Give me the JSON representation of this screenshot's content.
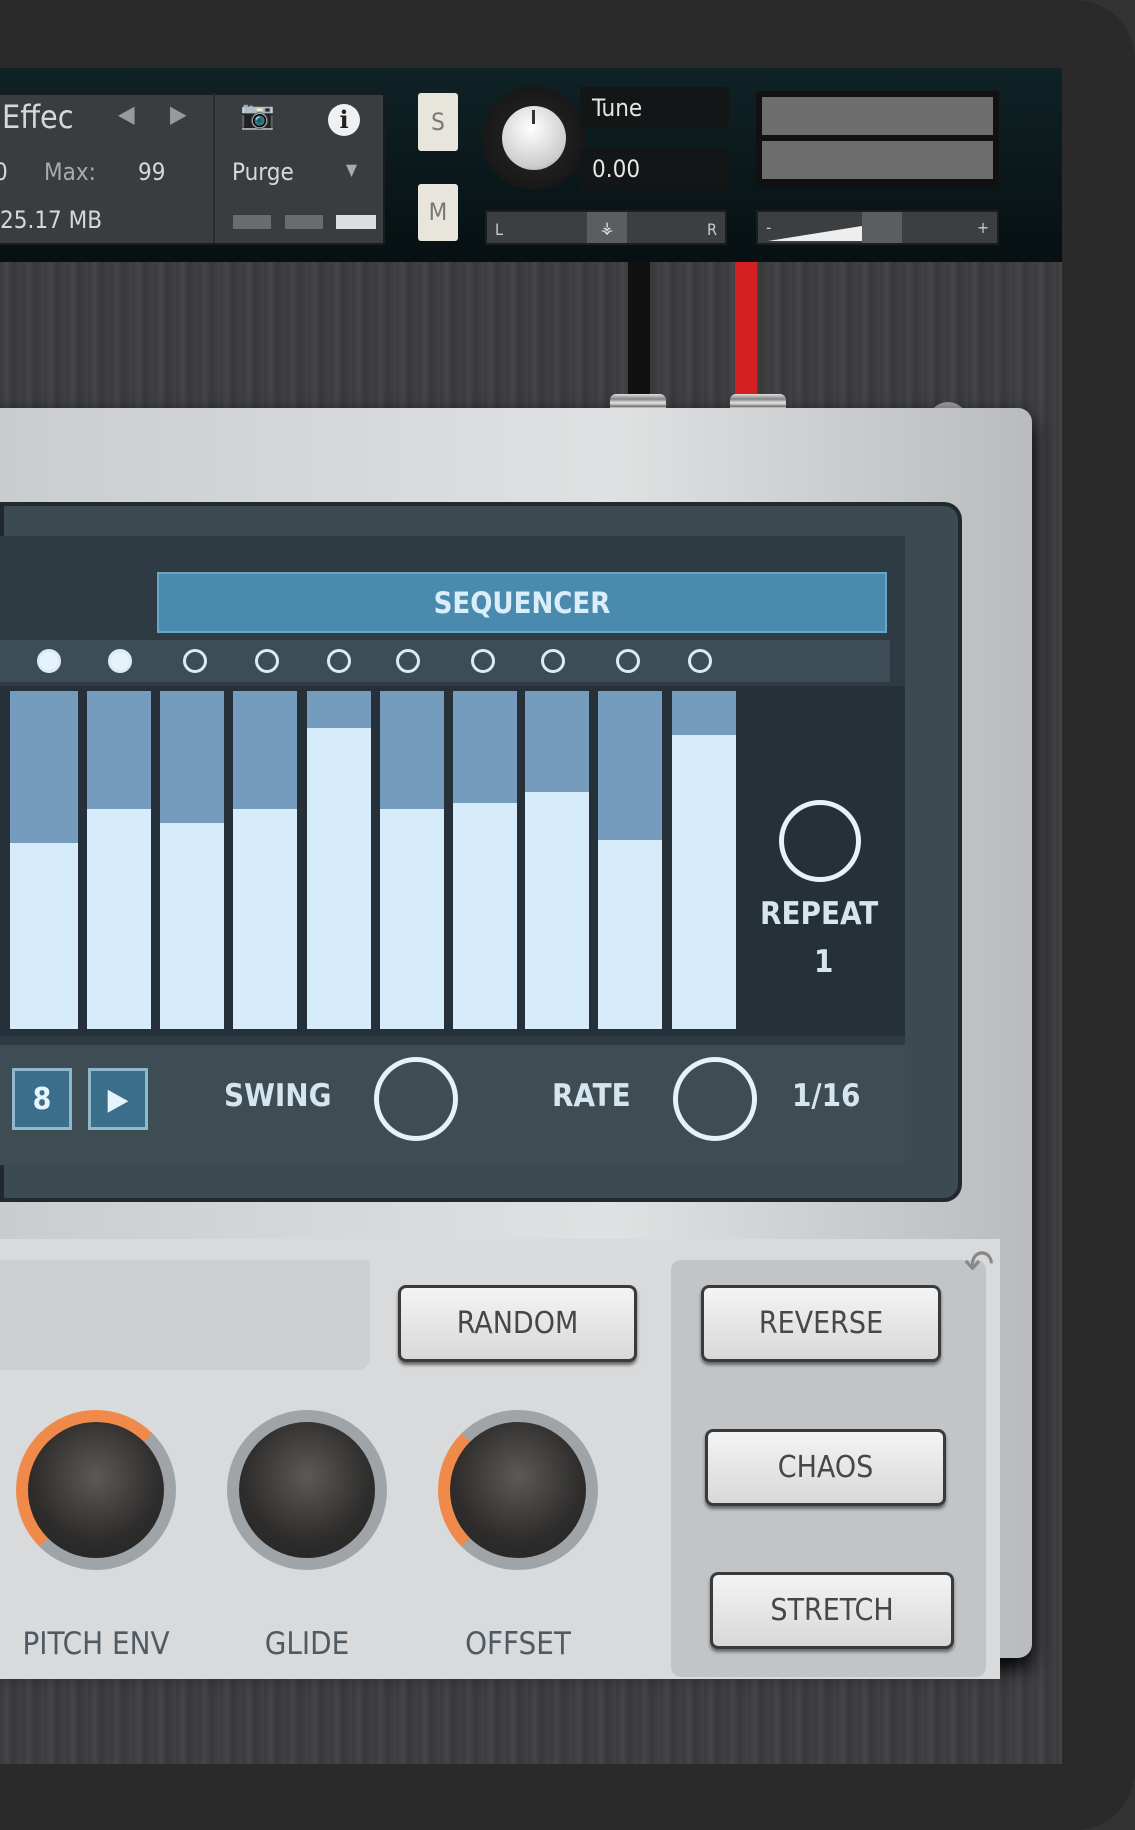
{
  "header": {
    "instrument_name": "Effec",
    "voices_label": "0",
    "max_label": "Max:",
    "max_value": "99",
    "purge_label": "Purge",
    "memory": "25.17 MB",
    "solo_label": "S",
    "mute_label": "M",
    "tune_label": "Tune",
    "tune_value": "0.00",
    "pan_left": "L",
    "pan_right": "R",
    "volume_minus": "-",
    "volume_plus": "+"
  },
  "sequencer": {
    "tab_label": "SEQUENCER",
    "step_dots": [
      true,
      true,
      false,
      false,
      false,
      false,
      false,
      false,
      false,
      false
    ],
    "step_values": [
      0.55,
      0.65,
      0.61,
      0.65,
      0.89,
      0.65,
      0.67,
      0.7,
      0.56,
      0.87
    ],
    "repeat_label": "REPEAT",
    "repeat_value": "1",
    "steps_value": "8",
    "swing_label": "SWING",
    "rate_label": "RATE",
    "rate_value": "1/16"
  },
  "controls": {
    "random_label": "RANDOM",
    "reverse_label": "REVERSE",
    "chaos_label": "CHAOS",
    "stretch_label": "STRETCH",
    "knobs": [
      {
        "label": "PITCH ENV"
      },
      {
        "label": "GLIDE"
      },
      {
        "label": "OFFSET"
      }
    ]
  },
  "colors": {
    "accent": "#4a8aae",
    "bar_fill": "#d6ecfa",
    "bar_bg": "#759bbd",
    "knob_arc": "#f08a4b",
    "cable_red": "#d42020"
  }
}
